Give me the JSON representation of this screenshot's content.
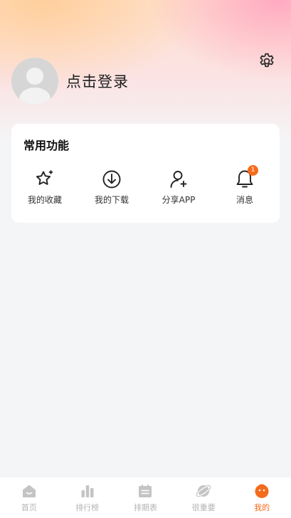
{
  "header": {
    "login_text": "点击登录"
  },
  "functions": {
    "title": "常用功能",
    "items": [
      {
        "label": "我的收藏",
        "icon": "star-sparkle-icon"
      },
      {
        "label": "我的下载",
        "icon": "download-icon"
      },
      {
        "label": "分享APP",
        "icon": "add-user-icon"
      },
      {
        "label": "消息",
        "icon": "bell-icon",
        "badge": "1"
      }
    ]
  },
  "tabbar": {
    "items": [
      {
        "label": "首页",
        "icon": "home-icon",
        "active": false
      },
      {
        "label": "排行榜",
        "icon": "bar-chart-icon",
        "active": false
      },
      {
        "label": "排期表",
        "icon": "calendar-icon",
        "active": false
      },
      {
        "label": "很重要",
        "icon": "planet-icon",
        "active": false
      },
      {
        "label": "我的",
        "icon": "profile-face-icon",
        "active": true
      }
    ]
  },
  "colors": {
    "accent": "#f56b1c",
    "badge": "#f76b1c",
    "inactive_tab": "#b4b4b4"
  }
}
